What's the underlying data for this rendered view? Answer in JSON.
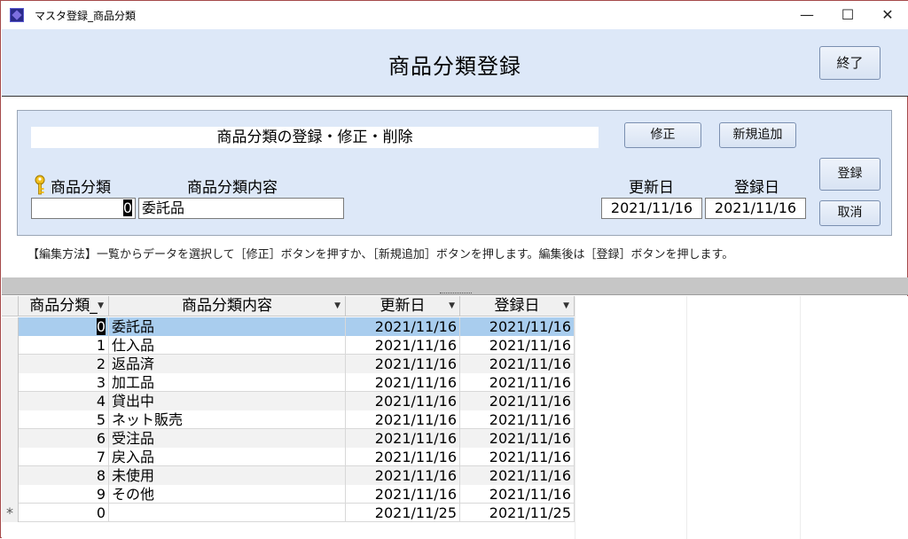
{
  "window": {
    "title": "マスタ登録_商品分類",
    "minimize": "—",
    "maximize": "☐",
    "close": "✕"
  },
  "header": {
    "title": "商品分類登録",
    "exit_label": "終了"
  },
  "panel": {
    "caption": "商品分類の登録・修正・削除",
    "modify_label": "修正",
    "new_label": "新規追加",
    "register_label": "登録",
    "cancel_label": "取消",
    "labels": {
      "code": "商品分類",
      "content": "商品分類内容",
      "updated": "更新日",
      "registered": "登録日"
    },
    "fields": {
      "code": "0",
      "content": "委託品",
      "updated": "2021/11/16",
      "registered": "2021/11/16"
    }
  },
  "instructions": "【編集方法】一覧からデータを選択して［修正］ボタンを押すか、［新規追加］ボタンを押します。編集後は［登録］ボタンを押します。",
  "grid": {
    "columns": [
      "商品分類_",
      "商品分類内容",
      "更新日",
      "登録日"
    ],
    "rows": [
      {
        "code": "0",
        "content": "委託品",
        "updated": "2021/11/16",
        "registered": "2021/11/16"
      },
      {
        "code": "1",
        "content": "仕入品",
        "updated": "2021/11/16",
        "registered": "2021/11/16"
      },
      {
        "code": "2",
        "content": "返品済",
        "updated": "2021/11/16",
        "registered": "2021/11/16"
      },
      {
        "code": "3",
        "content": "加工品",
        "updated": "2021/11/16",
        "registered": "2021/11/16"
      },
      {
        "code": "4",
        "content": "貸出中",
        "updated": "2021/11/16",
        "registered": "2021/11/16"
      },
      {
        "code": "5",
        "content": "ネット販売",
        "updated": "2021/11/16",
        "registered": "2021/11/16"
      },
      {
        "code": "6",
        "content": "受注品",
        "updated": "2021/11/16",
        "registered": "2021/11/16"
      },
      {
        "code": "7",
        "content": "戻入品",
        "updated": "2021/11/16",
        "registered": "2021/11/16"
      },
      {
        "code": "8",
        "content": "未使用",
        "updated": "2021/11/16",
        "registered": "2021/11/16"
      },
      {
        "code": "9",
        "content": "その他",
        "updated": "2021/11/16",
        "registered": "2021/11/16"
      }
    ],
    "new_row": {
      "marker": "*",
      "code": "0",
      "content": "",
      "updated": "2021/11/25",
      "registered": "2021/11/25"
    }
  },
  "colors": {
    "header_bg": "#dde8f8",
    "selected_row": "#a9cdee",
    "window_border": "#a54a4a"
  }
}
